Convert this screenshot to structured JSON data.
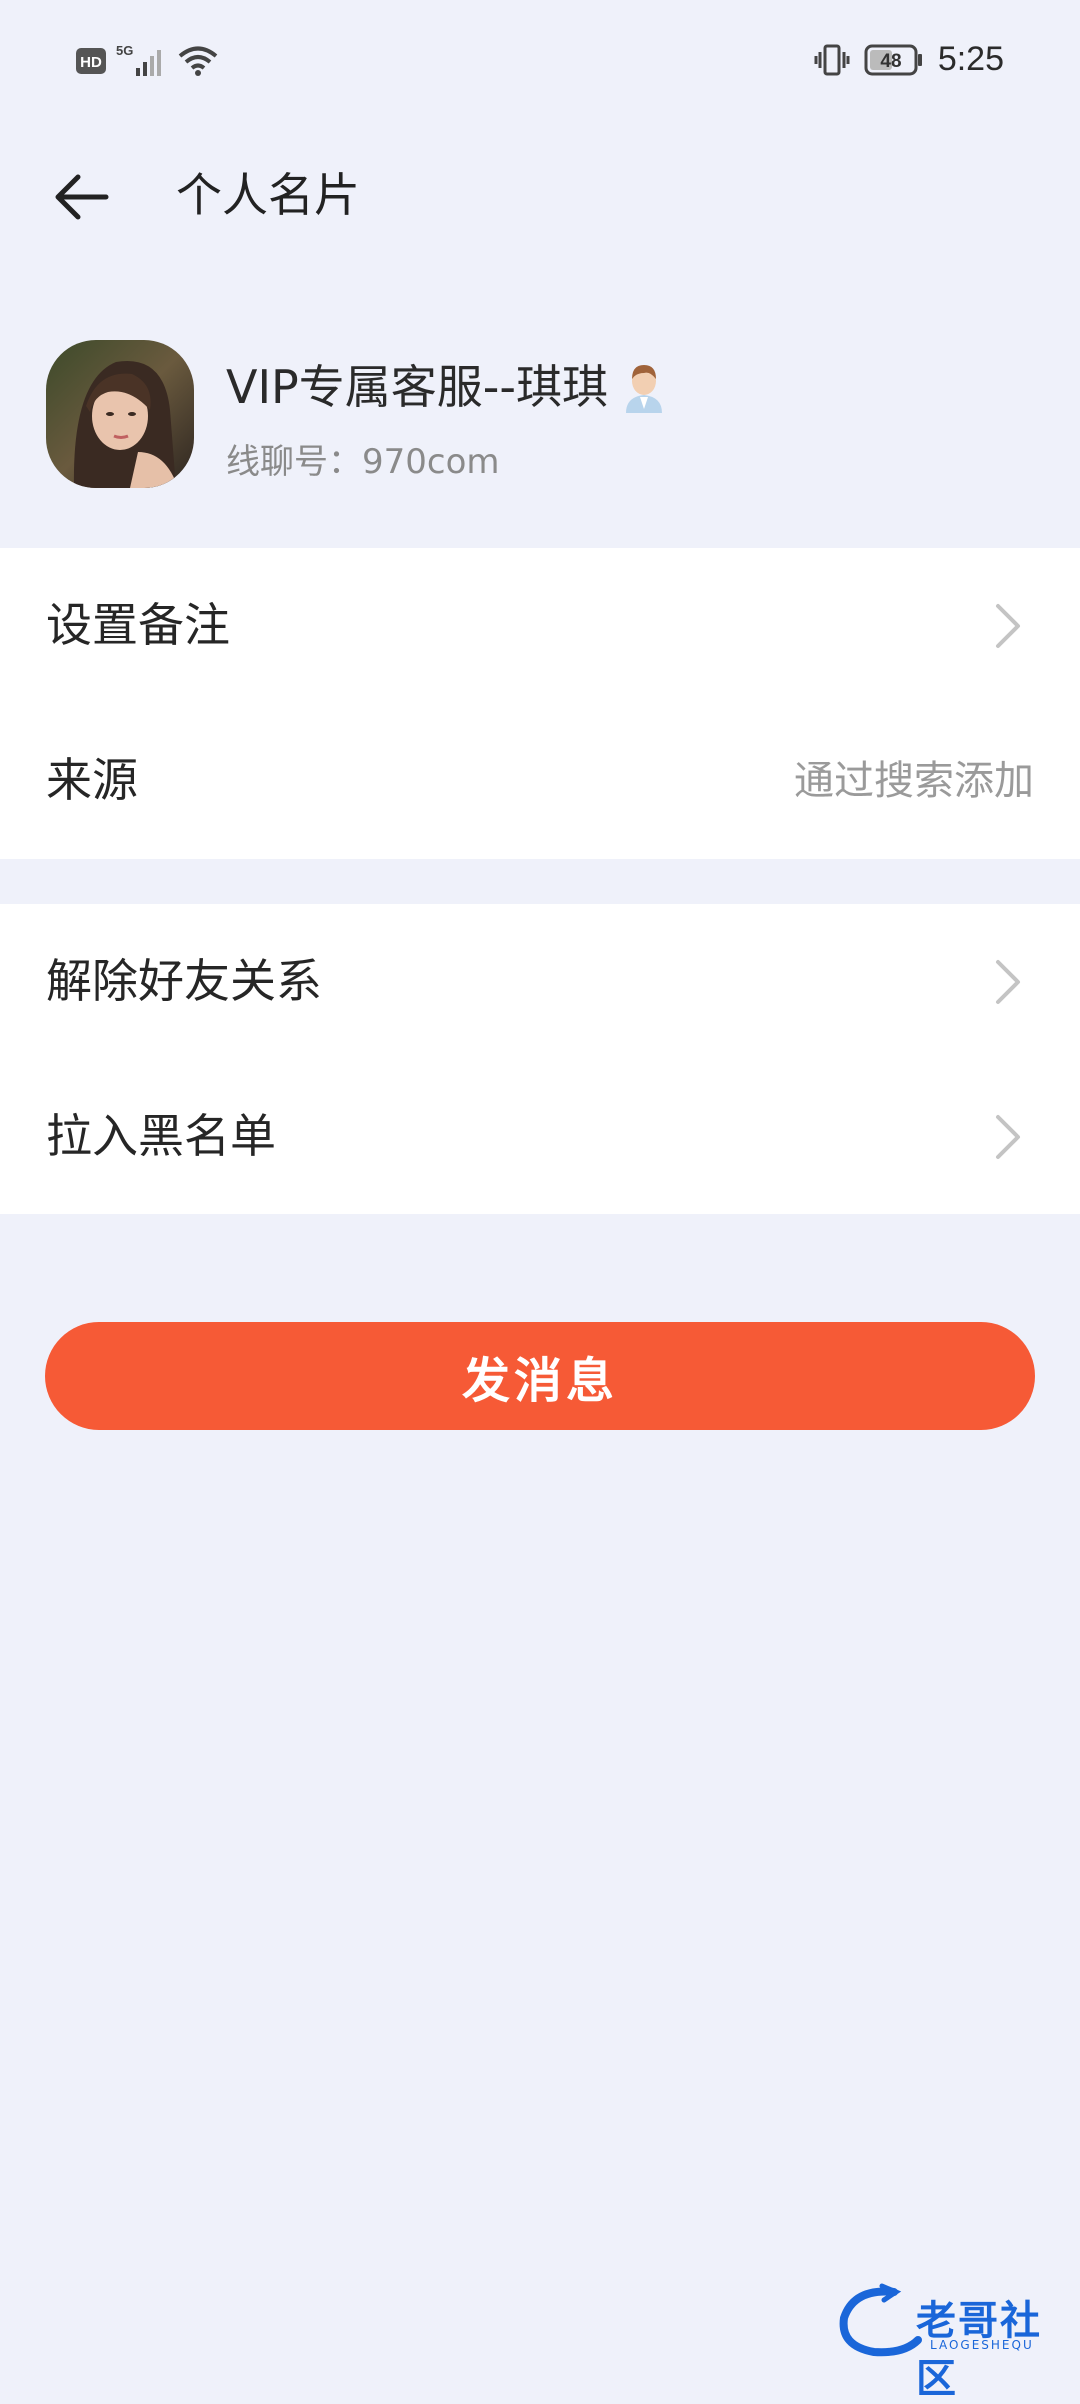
{
  "status_bar": {
    "hd_label": "HD",
    "network_label": "5G",
    "battery_level": "48",
    "time": "5:25"
  },
  "header": {
    "title": "个人名片"
  },
  "profile": {
    "name": "VIP专属客服--琪琪",
    "id_label": "线聊号：",
    "id_value": "970com"
  },
  "section1": {
    "set_remark_label": "设置备注",
    "source_label": "来源",
    "source_value": "通过搜索添加"
  },
  "section2": {
    "remove_friend_label": "解除好友关系",
    "blacklist_label": "拉入黑名单"
  },
  "actions": {
    "send_message_label": "发消息"
  },
  "watermark": {
    "text": "老哥社区",
    "subtext": "LAOGESHEQU"
  },
  "colors": {
    "background": "#eff1fa",
    "accent": "#f65a36",
    "card": "#ffffff"
  }
}
